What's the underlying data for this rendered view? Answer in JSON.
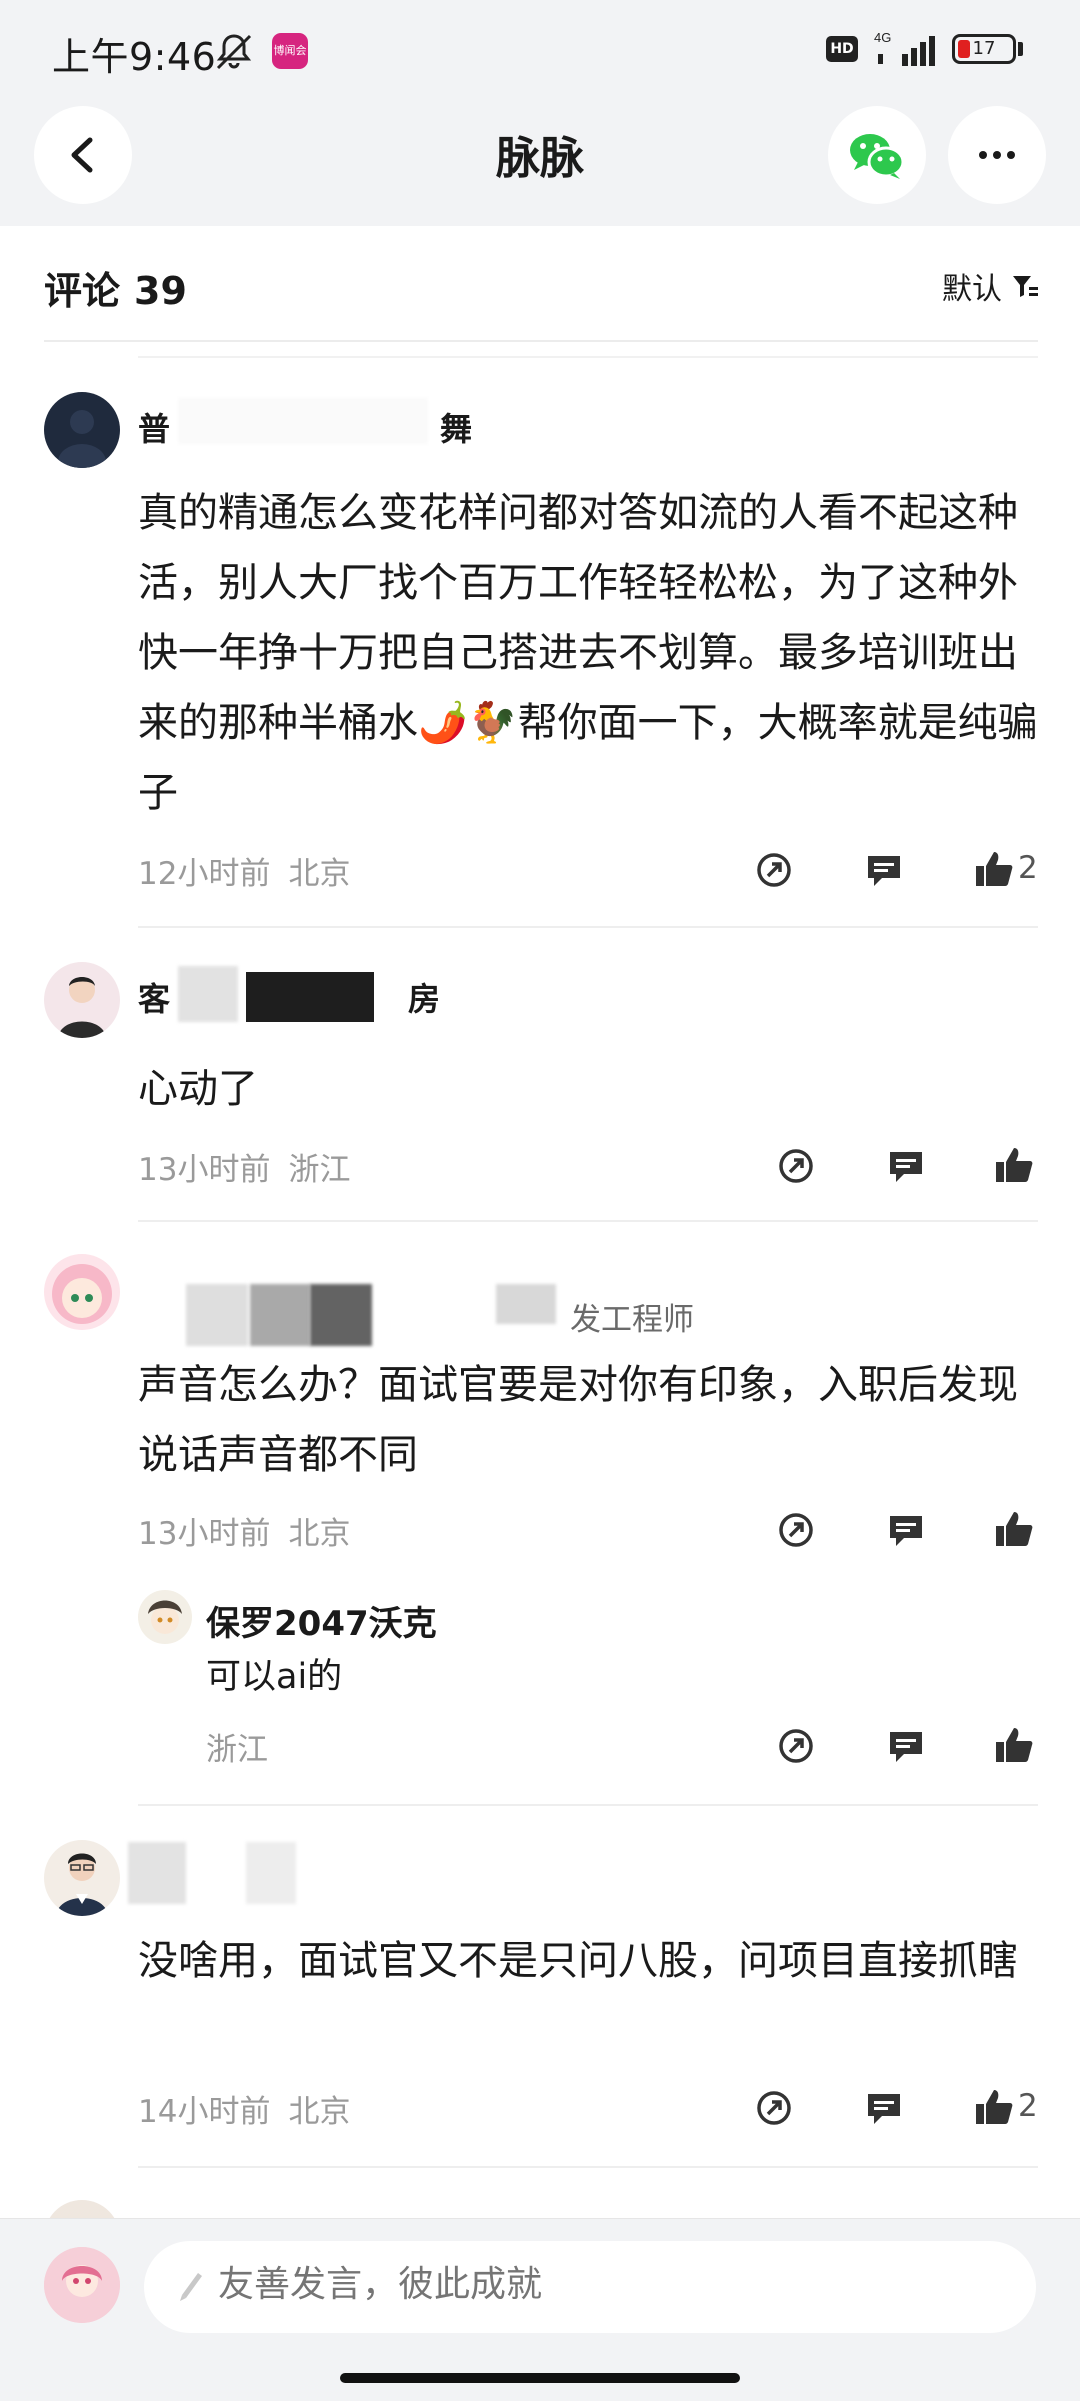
{
  "status_bar": {
    "time": "上午9:46",
    "hd": "HD",
    "network": "4G",
    "battery": "17",
    "app_badge": "博闻会"
  },
  "header": {
    "title": "脉脉"
  },
  "comments_header": {
    "label": "评论",
    "count": "39",
    "sort_label": "默认"
  },
  "comments": [
    {
      "name_visible": "普",
      "name_tail": "舞",
      "text": "真的精通怎么变花样问都对答如流的人看不起这种活，别人大厂找个百万工作轻轻松松，为了这种外快一年挣十万把自己搭进去不划算。最多培训班出来的那种半桶水🌶️🐓帮你面一下，大概率就是纯骗子",
      "time": "12小时前",
      "location": "北京",
      "likes": "2"
    },
    {
      "name_visible": "客",
      "name_tail": "房",
      "text": "心动了",
      "time": "13小时前",
      "location": "浙江",
      "likes": ""
    },
    {
      "name_visible": "",
      "name_tail": "发工程师",
      "text": "声音怎么办？面试官要是对你有印象，入职后发现说话声音都不同",
      "time": "13小时前",
      "location": "北京",
      "likes": "",
      "reply": {
        "name": "保罗2047沃克",
        "text": "可以ai的",
        "location": "浙江"
      }
    },
    {
      "name_visible": "",
      "name_tail": "",
      "text": "没啥用，面试官又不是只问八股，问项目直接抓瞎",
      "time": "14小时前",
      "location": "北京",
      "likes": "2"
    }
  ],
  "input": {
    "placeholder": "友善发言，彼此成就"
  },
  "colors": {
    "background": "#f2f3f5",
    "text": "#1a1a1a",
    "muted": "#9a9a9a",
    "wechat": "#2dc84d"
  }
}
